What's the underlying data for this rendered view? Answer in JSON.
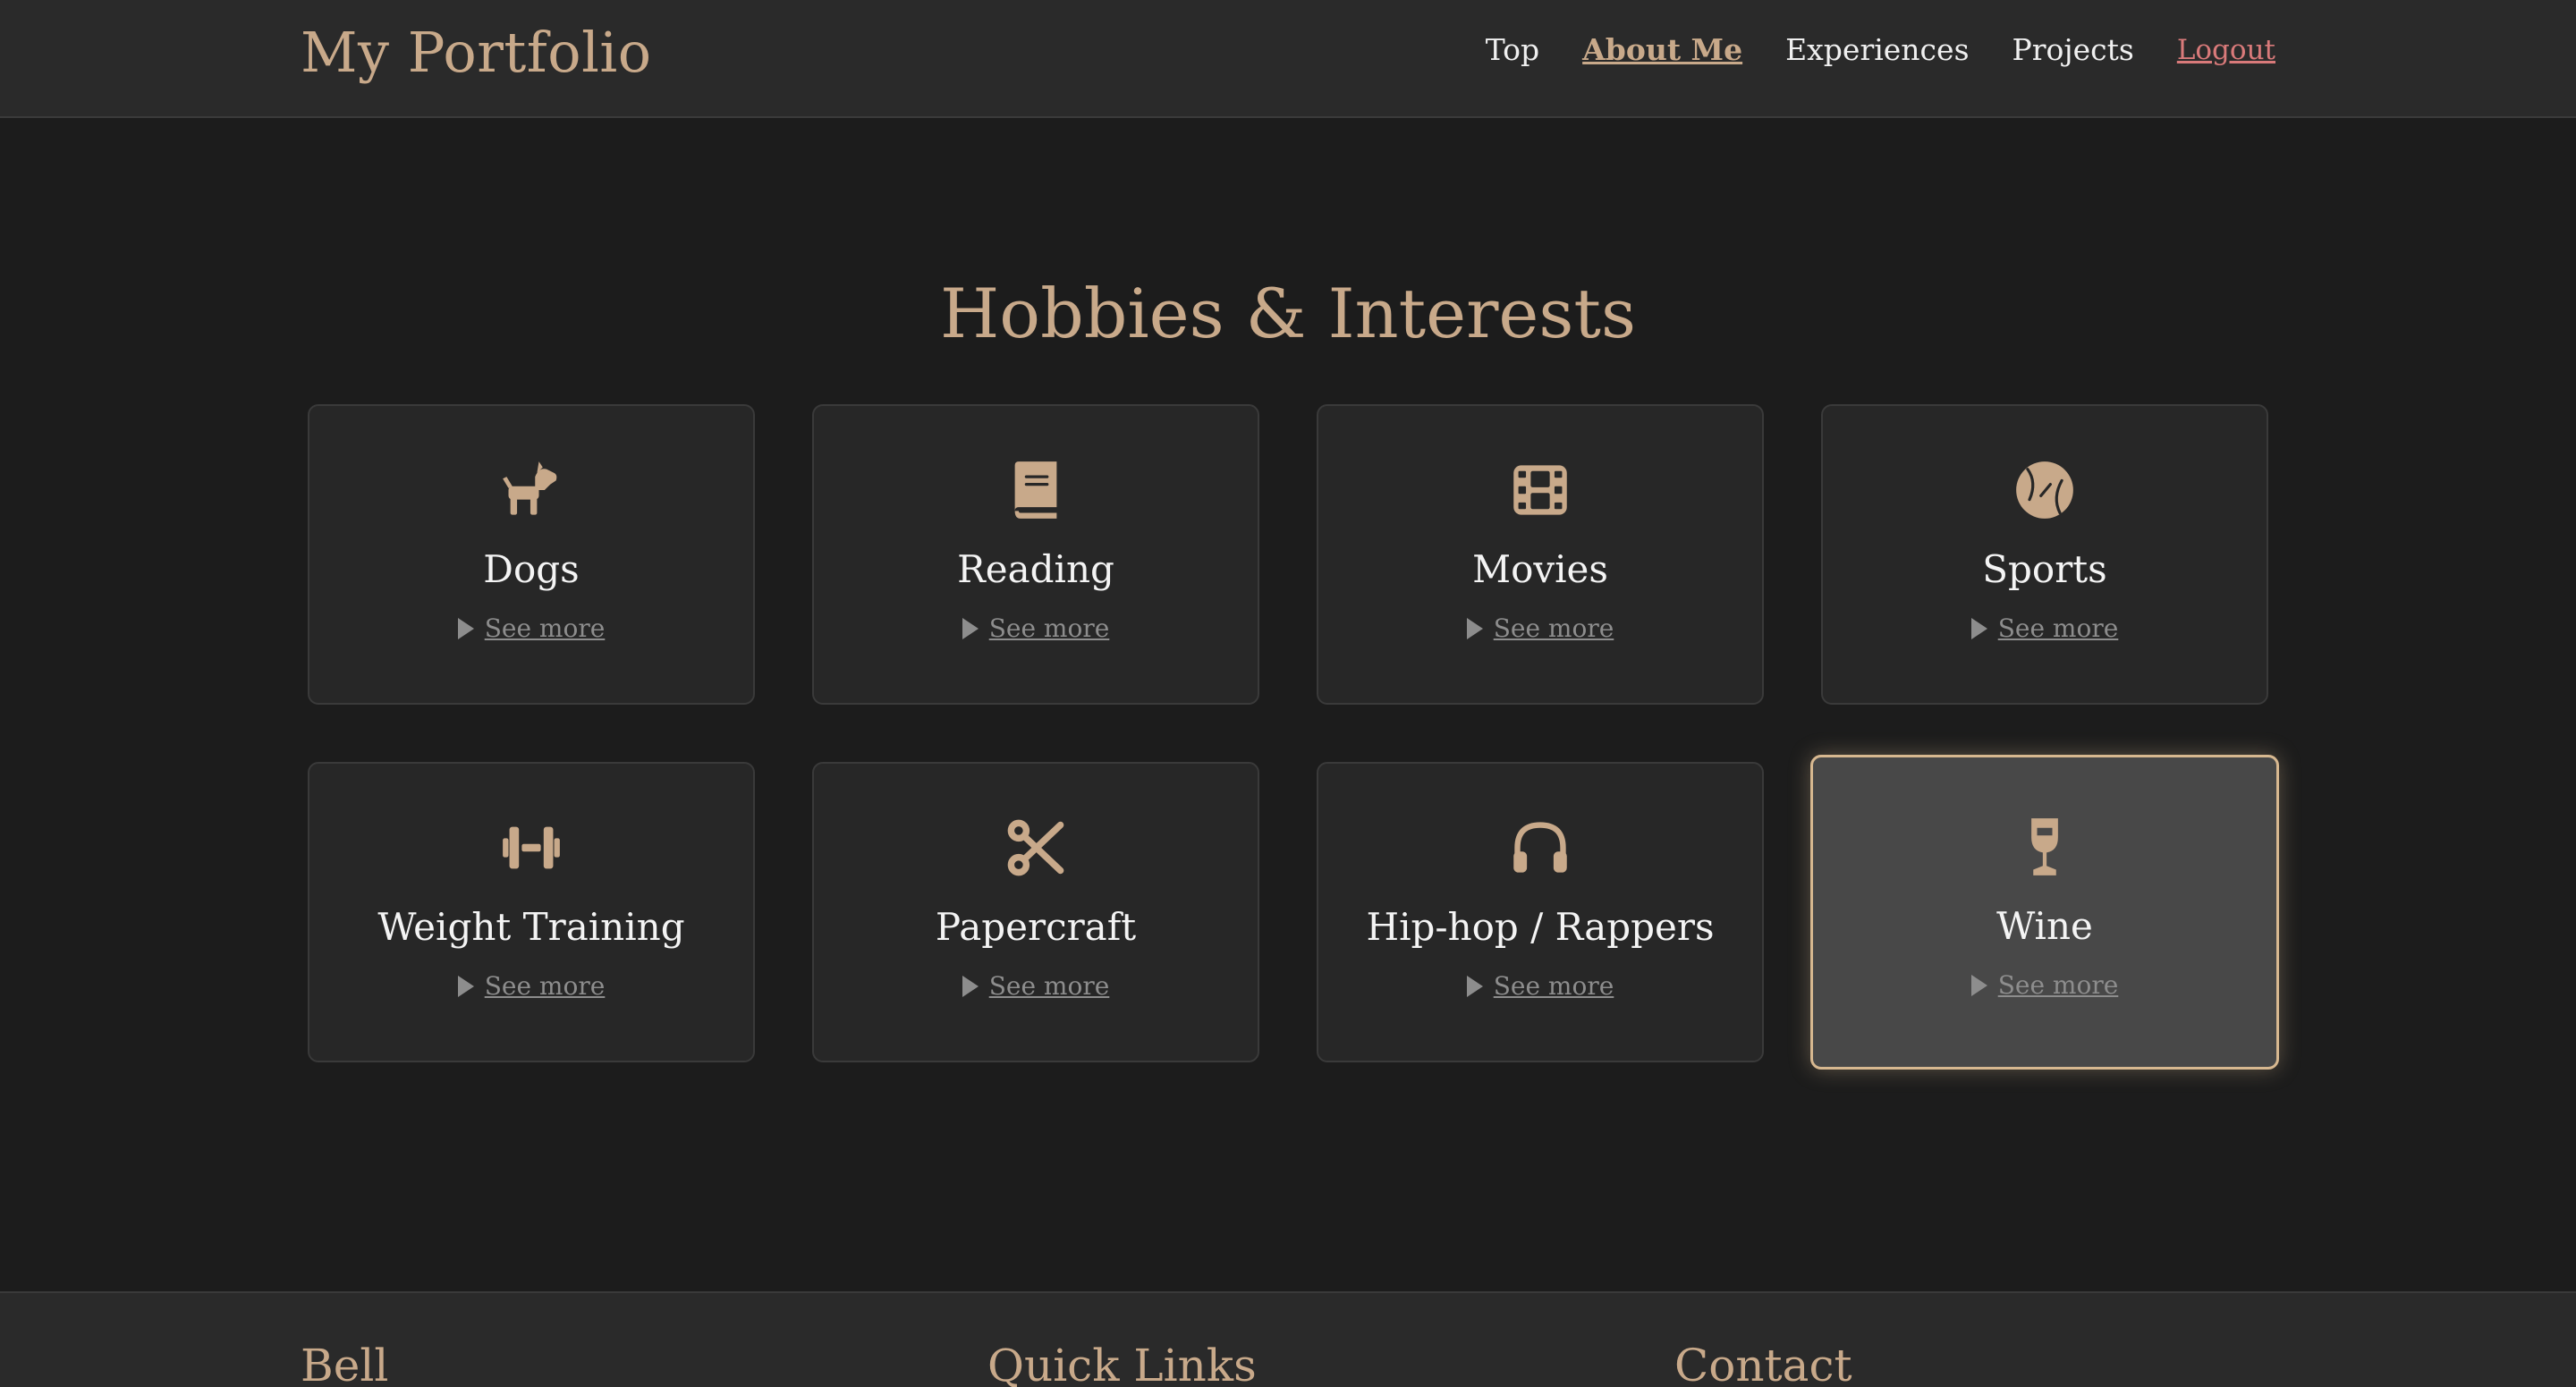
{
  "header": {
    "brand": "My Portfolio",
    "nav": {
      "top": "Top",
      "about": "About Me",
      "experiences": "Experiences",
      "projects": "Projects",
      "logout": "Logout"
    }
  },
  "section": {
    "title": "Hobbies & Interests"
  },
  "cards": [
    {
      "label": "Dogs",
      "more": "See more",
      "icon": "dog-icon"
    },
    {
      "label": "Reading",
      "more": "See more",
      "icon": "book-icon"
    },
    {
      "label": "Movies",
      "more": "See more",
      "icon": "film-icon"
    },
    {
      "label": "Sports",
      "more": "See more",
      "icon": "baseball-icon"
    },
    {
      "label": "Weight Training",
      "more": "See more",
      "icon": "dumbbell-icon"
    },
    {
      "label": "Papercraft",
      "more": "See more",
      "icon": "scissors-icon"
    },
    {
      "label": "Hip-hop / Rappers",
      "more": "See more",
      "icon": "headphones-icon"
    },
    {
      "label": "Wine",
      "more": "See more",
      "icon": "wine-glass-icon"
    }
  ],
  "footer": {
    "col1": "Bell",
    "col2": "Quick Links",
    "col3": "Contact"
  },
  "colors": {
    "accent": "#c8a98a",
    "background": "#1c1c1c",
    "card": "#272727",
    "logout": "#d97a7a"
  }
}
